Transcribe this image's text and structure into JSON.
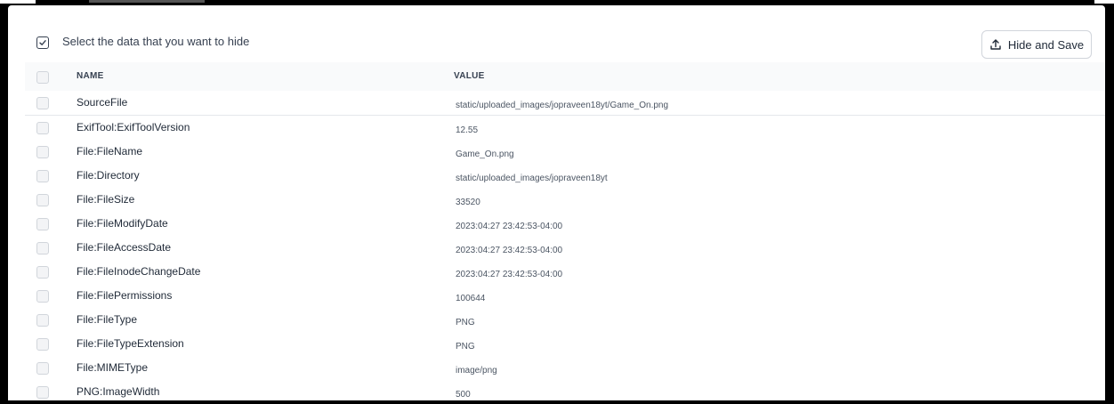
{
  "toolbar": {
    "select_text": "Select the data that you want to hide",
    "hide_save_label": "Hide and Save"
  },
  "table": {
    "headers": {
      "name": "NAME",
      "value": "VALUE"
    },
    "rows": [
      {
        "name": "SourceFile",
        "value": "static/uploaded_images/jopraveen18yt/Game_On.png"
      },
      {
        "name": "ExifTool:ExifToolVersion",
        "value": "12.55"
      },
      {
        "name": "File:FileName",
        "value": "Game_On.png"
      },
      {
        "name": "File:Directory",
        "value": "static/uploaded_images/jopraveen18yt"
      },
      {
        "name": "File:FileSize",
        "value": "33520"
      },
      {
        "name": "File:FileModifyDate",
        "value": "2023:04:27 23:42:53-04:00"
      },
      {
        "name": "File:FileAccessDate",
        "value": "2023:04:27 23:42:53-04:00"
      },
      {
        "name": "File:FileInodeChangeDate",
        "value": "2023:04:27 23:42:53-04:00"
      },
      {
        "name": "File:FilePermissions",
        "value": "100644"
      },
      {
        "name": "File:FileType",
        "value": "PNG"
      },
      {
        "name": "File:FileTypeExtension",
        "value": "PNG"
      },
      {
        "name": "File:MIMEType",
        "value": "image/png"
      },
      {
        "name": "PNG:ImageWidth",
        "value": "500"
      }
    ]
  },
  "icons": {
    "select_icon": "checkbox-checked-icon",
    "hide_save_icon": "upload-icon"
  }
}
